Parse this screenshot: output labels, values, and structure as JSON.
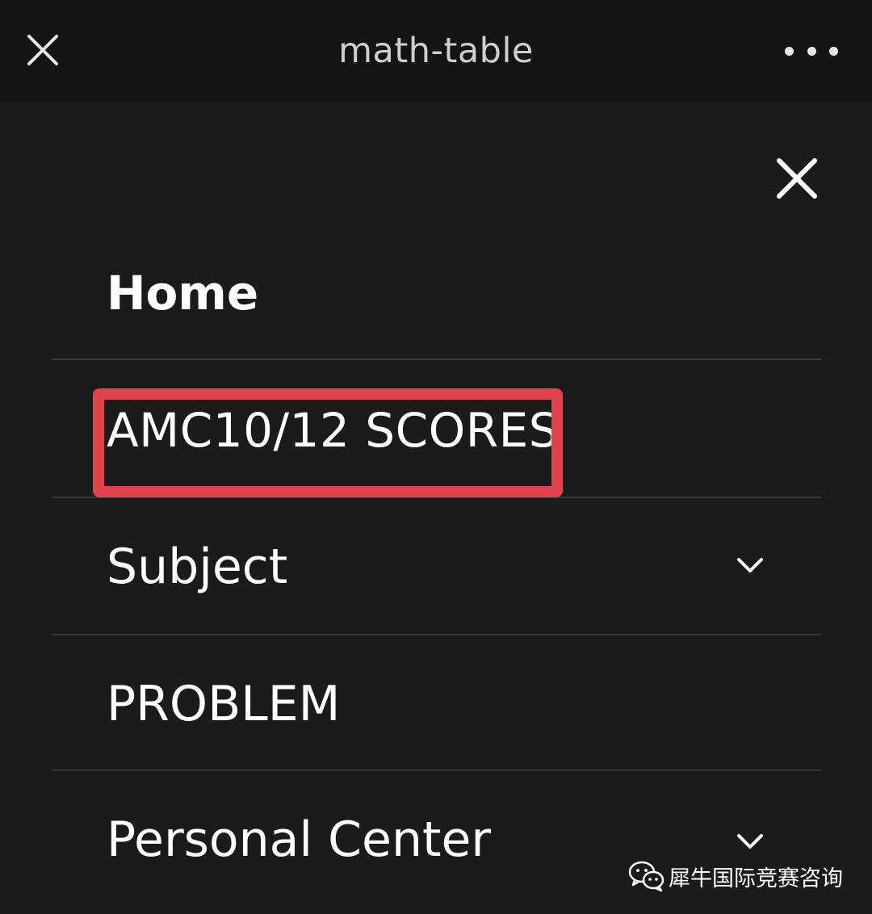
{
  "header": {
    "title": "math-table",
    "close_icon": "close-icon",
    "more_icon": "more-horizontal-icon"
  },
  "menu": {
    "close_icon": "close-icon",
    "items": [
      {
        "label": "Home",
        "bold": true,
        "expandable": false
      },
      {
        "label": "AMC10/12 SCORES",
        "bold": false,
        "expandable": false,
        "highlighted": true
      },
      {
        "label": "Subject",
        "bold": false,
        "expandable": true,
        "expand_icon": "chevron-down-icon"
      },
      {
        "label": "PROBLEM",
        "bold": false,
        "expandable": false
      },
      {
        "label": "Personal Center",
        "bold": false,
        "expandable": true,
        "expand_icon": "chevron-down-icon"
      }
    ]
  },
  "annotation": {
    "highlight_color": "#e0424b"
  },
  "watermark": {
    "text": "犀牛国际竞赛咨询",
    "icon": "wechat-icon"
  },
  "colors": {
    "background": "#1b1b1b",
    "topbar": "#141414",
    "divider": "#3a3a3a",
    "text": "#ffffff"
  }
}
